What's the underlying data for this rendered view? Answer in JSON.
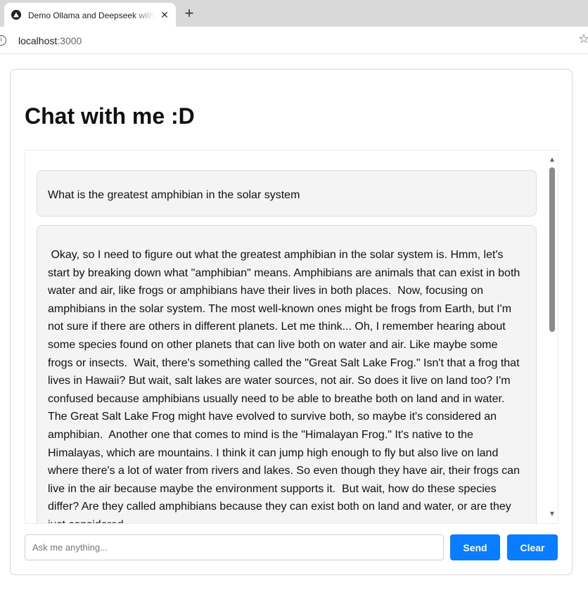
{
  "browser": {
    "tab_title": "Demo Ollama and Deepseek with Next.js",
    "tab_close": "✕",
    "new_tab": "+",
    "url_host": "localhost",
    "url_port": ":3000",
    "info_icon": "i",
    "star_icon": "☆"
  },
  "page": {
    "title": "Chat with me :D"
  },
  "chat": {
    "messages": [
      {
        "role": "user",
        "text": "What is the greatest amphibian in the solar system"
      },
      {
        "role": "assistant",
        "text": " Okay, so I need to figure out what the greatest amphibian in the solar system is. Hmm, let's start by breaking down what \"amphibian\" means. Amphibians are animals that can exist in both water and air, like frogs or amphibians have their lives in both places.  Now, focusing on amphibians in the solar system. The most well-known ones might be frogs from Earth, but I'm not sure if there are others in different planets. Let me think... Oh, I remember hearing about some species found on other planets that can live both on water and air. Like maybe some frogs or insects.  Wait, there's something called the \"Great Salt Lake Frog.\" Isn't that a frog that lives in Hawaii? But wait, salt lakes are water sources, not air. So does it live on land too? I'm confused because amphibians usually need to be able to breathe both on land and in water. The Great Salt Lake Frog might have evolved to survive both, so maybe it's considered an amphibian.  Another one that comes to mind is the \"Himalayan Frog.\" It's native to the Himalayas, which are mountains. I think it can jump high enough to fly but also live on land where there's a lot of water from rivers and lakes. So even though they have air, their frogs can live in the air because maybe the environment supports it.  But wait, how do these species differ? Are they called amphibians because they can exist both on land and water, or are they just considered"
      }
    ],
    "scroll_up": "▲",
    "scroll_down": "▼"
  },
  "input": {
    "placeholder": "Ask me anything...",
    "value": ""
  },
  "buttons": {
    "send": "Send",
    "clear": "Clear"
  },
  "colors": {
    "accent": "#0a7cff",
    "message_bg": "#f4f4f4"
  }
}
